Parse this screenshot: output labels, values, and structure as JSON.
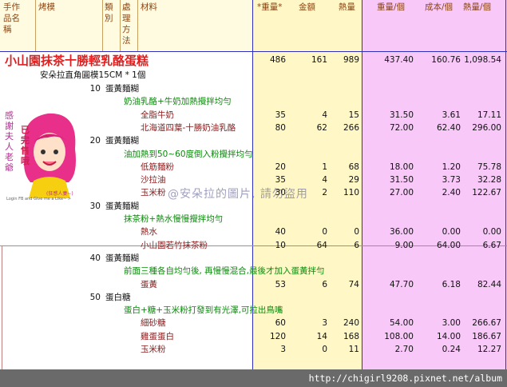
{
  "headers": {
    "col_name": "手作品名稱",
    "col_mold": "烤模",
    "col_category": "類別",
    "col_method": "處理方法",
    "col_material": "材料",
    "col_weight": "*重量*",
    "col_amount": "金額",
    "col_heat": "熱量",
    "col_weight_each": "重量/個",
    "col_cost_each": "成本/個",
    "col_heat_each": "熱量/個"
  },
  "product": {
    "title": "小山園抹茶十勝輕乳酪蛋糕",
    "mold": "安朵拉直角圓模15CM * 1個",
    "weight": "486",
    "amount": "161",
    "heat": "989",
    "weight_each": "437.40",
    "cost_each": "160.76",
    "heat_each": "1,098.54"
  },
  "rows": [
    {
      "kind": "step",
      "num": "10",
      "text": "蛋黃麵糊"
    },
    {
      "kind": "method",
      "text": "奶油乳酪+牛奶加熱攪拌均勻"
    },
    {
      "kind": "item",
      "text": "全脂牛奶",
      "w": "35",
      "a": "4",
      "h": "15",
      "we": "31.50",
      "ce": "3.61",
      "he": "17.11"
    },
    {
      "kind": "item",
      "text": "北海道四葉-十勝奶油乳酪",
      "w": "80",
      "a": "62",
      "h": "266",
      "we": "72.00",
      "ce": "62.40",
      "he": "296.00"
    },
    {
      "kind": "step",
      "num": "20",
      "text": "蛋黃麵糊"
    },
    {
      "kind": "method",
      "text": "油加熱到50~60度倒入粉攪拌均勻"
    },
    {
      "kind": "item",
      "text": "低筋麵粉",
      "w": "20",
      "a": "1",
      "h": "68",
      "we": "18.00",
      "ce": "1.20",
      "he": "75.78"
    },
    {
      "kind": "item",
      "text": "沙拉油",
      "w": "35",
      "a": "4",
      "h": "29",
      "we": "31.50",
      "ce": "3.73",
      "he": "32.28"
    },
    {
      "kind": "item",
      "text": "玉米粉",
      "w": "30",
      "a": "2",
      "h": "110",
      "we": "27.00",
      "ce": "2.40",
      "he": "122.67"
    },
    {
      "kind": "step",
      "num": "30",
      "text": "蛋黃麵糊"
    },
    {
      "kind": "method",
      "text": "抹茶粉+熱水慢慢攪拌均勻"
    },
    {
      "kind": "item",
      "text": "熱水",
      "w": "40",
      "a": "0",
      "h": "0",
      "we": "36.00",
      "ce": "0.00",
      "he": "0.00"
    },
    {
      "kind": "item",
      "text": "小山園若竹抹茶粉",
      "w": "10",
      "a": "64",
      "h": "6",
      "we": "9.00",
      "ce": "64.00",
      "he": "6.67"
    },
    {
      "kind": "step",
      "num": "40",
      "text": "蛋黃麵糊"
    },
    {
      "kind": "method",
      "text": "前面三種各自均勻後, 再慢慢混合,最後才加入蛋黃拌勻"
    },
    {
      "kind": "item",
      "text": "蛋黃",
      "w": "53",
      "a": "6",
      "h": "74",
      "we": "47.70",
      "ce": "6.18",
      "he": "82.44"
    },
    {
      "kind": "step",
      "num": "50",
      "text": "蛋白糖"
    },
    {
      "kind": "method",
      "text": "蛋白+糖+玉米粉打發到有光澤,可拉出鳥嘴"
    },
    {
      "kind": "item",
      "text": "細砂糖",
      "w": "60",
      "a": "3",
      "h": "240",
      "we": "54.00",
      "ce": "3.00",
      "he": "266.67"
    },
    {
      "kind": "item",
      "text": "雞蛋蛋白",
      "w": "120",
      "a": "14",
      "h": "168",
      "we": "108.00",
      "ce": "14.00",
      "he": "186.67"
    },
    {
      "kind": "item",
      "text": "玉米粉",
      "w": "3",
      "a": "0",
      "h": "11",
      "we": "2.70",
      "ce": "0.24",
      "he": "12.27"
    }
  ],
  "watermark": "@安朵拉的圖片, 請勿盜用",
  "avatar": {
    "badge": "已完售哦",
    "side_text": "感謝夫人老爺",
    "caption": "Login FB and Give me a Like~ >",
    "caption2": "(狂感人妻~)"
  },
  "footer": "http://chigirl9208.pixnet.net/album",
  "colors": {
    "yellow": "#fff8c6",
    "pink": "#f8c8f8",
    "blue_line": "#3030c0",
    "title_red": "#e02020",
    "method_green": "#0a8a0a",
    "ingredient_maroon": "#8b1a1a"
  }
}
